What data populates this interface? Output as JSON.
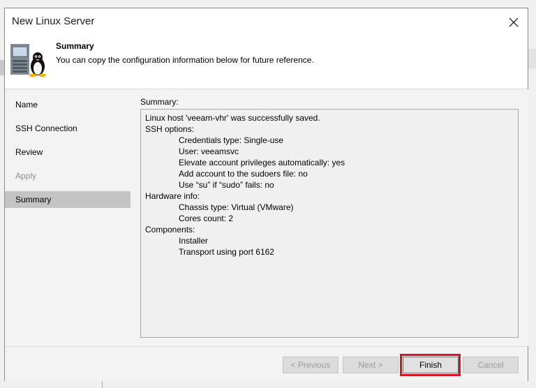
{
  "window": {
    "title": "New Linux Server",
    "close_icon": "close-icon"
  },
  "header": {
    "icon": "linux-server-icon",
    "title": "Summary",
    "subtitle": "You can copy the configuration information below for future reference."
  },
  "nav": {
    "items": [
      {
        "label": "Name",
        "state": "normal"
      },
      {
        "label": "SSH Connection",
        "state": "normal"
      },
      {
        "label": "Review",
        "state": "normal"
      },
      {
        "label": "Apply",
        "state": "disabled"
      },
      {
        "label": "Summary",
        "state": "active"
      }
    ]
  },
  "summary": {
    "label": "Summary:",
    "lines": [
      "Linux host 'veeam-vhr' was successfully saved.",
      "SSH options:",
      "Credentials type: Single-use",
      "User: veeamsvc",
      "Elevate account privileges automatically: yes",
      "Add account to the sudoers file: no",
      "Use “su” if “sudo” fails: no",
      "Hardware info:",
      "Chassis type: Virtual (VMware)",
      "Cores count: 2",
      "Components:",
      "Installer",
      "Transport using port 6162"
    ]
  },
  "footer": {
    "previous_label": "< Previous",
    "next_label": "Next >",
    "finish_label": "Finish",
    "cancel_label": "Cancel"
  },
  "colors": {
    "highlight": "#d8141f",
    "active_nav": "#c4c4c4"
  }
}
